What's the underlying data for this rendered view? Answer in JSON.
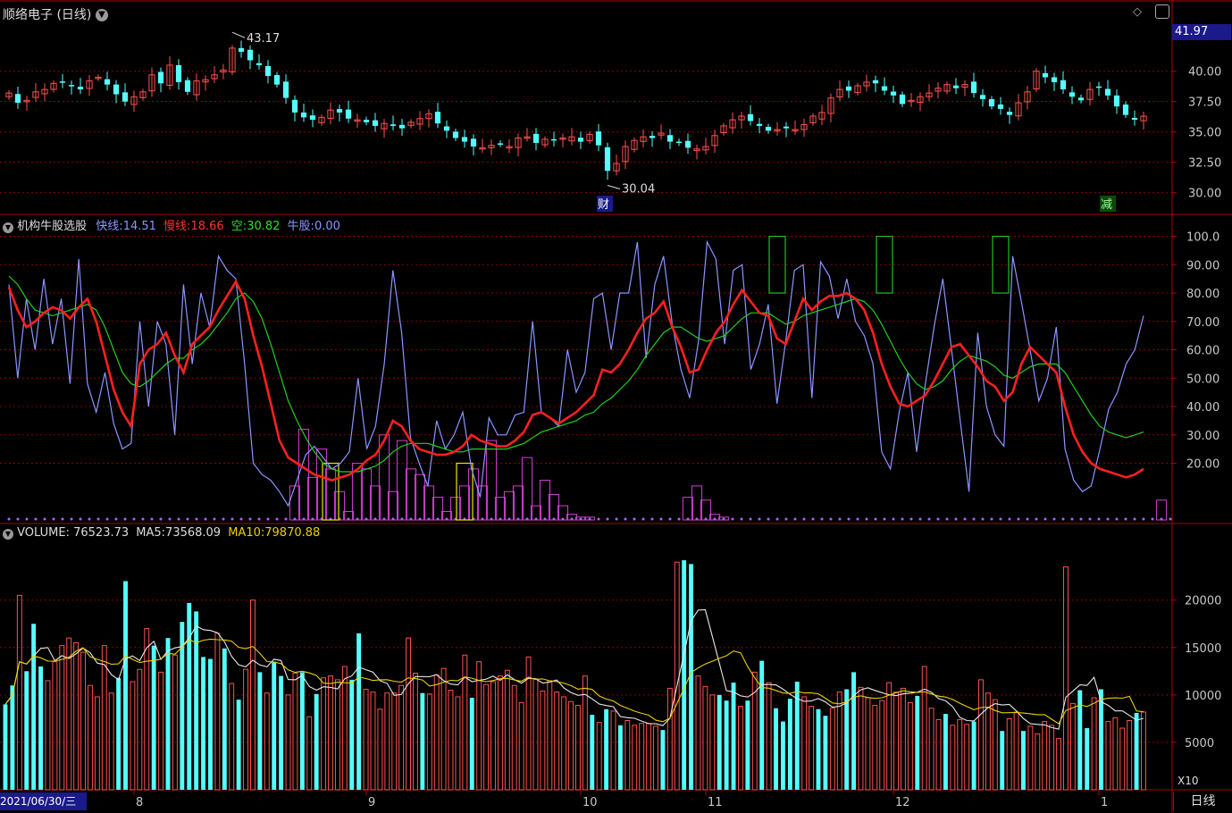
{
  "header": {
    "stock_name": "顺络电子",
    "period": "(日线)",
    "last_price": "41.97"
  },
  "price_panel": {
    "y_ticks": [
      "40.00",
      "37.50",
      "35.00",
      "32.50",
      "30.00"
    ],
    "high_label": "43.17",
    "low_label": "30.04",
    "marker_cai": "财",
    "marker_jian": "减"
  },
  "indicator_panel": {
    "name": "机构牛股选股",
    "fast_label": "快线:",
    "fast_value": "14.51",
    "slow_label": "慢线:",
    "slow_value": "18.66",
    "kong_label": "空:",
    "kong_value": "30.82",
    "niu_label": "牛股:",
    "niu_value": "0.00",
    "y_ticks": [
      "100.0",
      "90.00",
      "80.00",
      "70.00",
      "60.00",
      "50.00",
      "40.00",
      "30.00",
      "20.00"
    ]
  },
  "volume_panel": {
    "name": "VOLUME:",
    "volume_value": "76523.73",
    "ma5_label": "MA5:",
    "ma5_value": "73568.09",
    "ma10_label": "MA10:",
    "ma10_value": "79870.88",
    "y_ticks": [
      "20000",
      "15000",
      "10000",
      "5000"
    ],
    "unit": "X10"
  },
  "x_axis": {
    "start_date": "2021/06/30/三",
    "months": [
      "8",
      "9",
      "10",
      "11",
      "12",
      "1"
    ],
    "period_tab": "日线"
  },
  "colors": {
    "up": "#ff5050",
    "down": "#54ffff",
    "fast": "#8a96ff",
    "slow": "#ff2020",
    "kong": "#20d020",
    "niu": "#d040d0",
    "ma5": "#e8e8e8",
    "ma10": "#e8d000",
    "grid": "#8b0000"
  },
  "chart_data": [
    {
      "type": "candlestick",
      "title": "顺络电子 (日线)",
      "ylim": [
        28.8,
        43.8
      ],
      "series": [
        {
          "name": "price",
          "values": [
            38.2,
            37.4,
            37.6,
            38.3,
            38.5,
            39.0,
            39.1,
            38.8,
            38.5,
            39.2,
            39.5,
            38.9,
            38.1,
            37.5,
            37.9,
            38.3,
            39.7,
            39.0,
            40.5,
            39.1,
            38.3,
            39.2,
            39.3,
            39.7,
            40.1,
            41.9,
            41.6,
            40.9,
            40.5,
            39.6,
            38.9,
            37.8,
            36.6,
            36.2,
            36.0,
            36.2,
            36.8,
            36.6,
            36.1,
            36.0,
            35.8,
            35.5,
            35.7,
            35.5,
            35.3,
            35.8,
            36.1,
            36.5,
            35.7,
            35.1,
            34.5,
            34.2,
            33.8,
            33.7,
            33.9,
            34.0,
            33.8,
            34.5,
            34.6,
            34.1,
            34.4,
            34.3,
            34.5,
            34.6,
            34.2,
            34.8,
            33.9,
            31.8,
            32.4,
            33.8,
            34.3,
            34.6,
            34.5,
            34.9,
            34.2,
            34.1,
            33.7,
            33.6,
            33.8,
            34.7,
            35.5,
            36.0,
            36.3,
            35.9,
            35.5,
            35.1,
            35.2,
            35.3,
            35.2,
            35.6,
            36.3,
            36.6,
            37.8,
            38.5,
            38.4,
            38.8,
            39.1,
            39.0,
            38.4,
            38.0,
            37.3,
            37.6,
            37.9,
            38.2,
            38.6,
            38.9,
            38.6,
            38.9,
            38.2,
            37.7,
            37.1,
            36.9,
            36.4,
            37.4,
            38.3,
            40.0,
            39.5,
            39.1,
            38.5,
            37.9,
            37.6,
            38.5,
            38.7,
            38.0,
            37.1,
            36.4,
            36.0,
            36.3
          ]
        }
      ]
    },
    {
      "type": "line",
      "title": "机构牛股选股",
      "ylim": [
        0,
        103
      ],
      "series": [
        {
          "name": "快线",
          "values": [
            83,
            50,
            78,
            60,
            85,
            62,
            78,
            48,
            92,
            48,
            38,
            52,
            34,
            25,
            27,
            70,
            40,
            70,
            62,
            30,
            83,
            55,
            80,
            68,
            93,
            88,
            85,
            55,
            20,
            16,
            14,
            10,
            5,
            14,
            23,
            26,
            22,
            18,
            20,
            24,
            50,
            25,
            33,
            55,
            88,
            66,
            29,
            20,
            12,
            35,
            25,
            30,
            38,
            18,
            8,
            36,
            30,
            30,
            37,
            38,
            70,
            38,
            36,
            33,
            60,
            45,
            52,
            78,
            80,
            60,
            80,
            80,
            98,
            57,
            83,
            93,
            69,
            53,
            43,
            63,
            98,
            92,
            62,
            88,
            90,
            53,
            62,
            76,
            41,
            63,
            88,
            90,
            43,
            91,
            86,
            71,
            85,
            70,
            65,
            55,
            24,
            18,
            38,
            52,
            24,
            48,
            68,
            85,
            60,
            35,
            10,
            66,
            40,
            30,
            26,
            93,
            77,
            60,
            42,
            50,
            68,
            25,
            14,
            10,
            12,
            25,
            39,
            45,
            55,
            60,
            72
          ]
        },
        {
          "name": "慢线",
          "values": [
            82,
            74,
            68,
            70,
            73,
            75,
            74,
            71,
            75,
            78,
            70,
            58,
            46,
            38,
            33,
            55,
            60,
            62,
            66,
            58,
            52,
            62,
            65,
            68,
            74,
            79,
            84,
            78,
            65,
            54,
            41,
            28,
            22,
            20,
            18,
            16,
            15,
            14,
            15,
            16,
            18,
            21,
            23,
            28,
            35,
            33,
            28,
            25,
            24,
            23,
            23,
            24,
            26,
            30,
            28,
            27,
            26,
            26,
            28,
            31,
            37,
            38,
            36,
            34,
            36,
            38,
            41,
            44,
            53,
            52,
            55,
            60,
            66,
            71,
            73,
            77,
            68,
            61,
            52,
            53,
            60,
            66,
            70,
            76,
            81,
            77,
            73,
            72,
            64,
            62,
            70,
            78,
            74,
            77,
            79,
            79,
            80,
            78,
            74,
            66,
            55,
            47,
            41,
            40,
            42,
            44,
            49,
            55,
            61,
            62,
            58,
            54,
            49,
            47,
            42,
            45,
            55,
            61,
            58,
            55,
            52,
            40,
            30,
            24,
            20,
            18,
            17,
            16,
            15,
            16,
            18
          ]
        },
        {
          "name": "空",
          "values": [
            86,
            83,
            78,
            74,
            73,
            72,
            73,
            74,
            75,
            76,
            74,
            68,
            60,
            52,
            48,
            47,
            49,
            52,
            55,
            57,
            57,
            60,
            62,
            65,
            69,
            73,
            78,
            80,
            77,
            71,
            62,
            52,
            42,
            35,
            29,
            24,
            20,
            18,
            17,
            17,
            17,
            18,
            19,
            21,
            24,
            26,
            27,
            27,
            27,
            26,
            25,
            24,
            24,
            25,
            25,
            25,
            25,
            25,
            26,
            27,
            29,
            31,
            32,
            33,
            34,
            35,
            37,
            38,
            41,
            43,
            46,
            49,
            53,
            58,
            62,
            66,
            68,
            68,
            66,
            64,
            63,
            64,
            65,
            68,
            71,
            73,
            73,
            73,
            71,
            69,
            70,
            72,
            73,
            74,
            75,
            76,
            77,
            78,
            77,
            74,
            69,
            63,
            57,
            52,
            48,
            46,
            47,
            49,
            53,
            56,
            58,
            57,
            56,
            54,
            51,
            50,
            52,
            54,
            55,
            55,
            55,
            52,
            47,
            42,
            37,
            33,
            31,
            30,
            29,
            30,
            31
          ]
        },
        {
          "name": "牛股",
          "values": [
            0,
            0,
            0,
            0,
            0,
            0,
            0,
            0,
            0,
            0,
            0,
            0,
            0,
            0,
            0,
            0,
            0,
            0,
            0,
            0,
            0,
            0,
            0,
            0,
            0,
            0,
            0,
            0,
            0,
            0,
            0,
            0,
            12,
            32,
            15,
            25,
            18,
            10,
            3,
            20,
            18,
            12,
            30,
            10,
            28,
            18,
            16,
            12,
            8,
            3,
            8,
            12,
            18,
            12,
            28,
            8,
            10,
            12,
            22,
            5,
            14,
            9,
            5,
            2,
            1,
            1,
            0,
            0,
            0,
            0,
            0,
            0,
            0,
            0,
            0,
            0,
            8,
            12,
            7,
            2,
            1,
            0,
            0,
            0,
            0,
            0,
            0,
            0,
            0,
            0,
            0,
            0,
            0,
            0,
            0,
            0,
            0,
            0,
            0,
            0,
            0,
            0,
            0,
            0,
            0,
            0,
            0,
            0,
            0,
            0,
            0,
            0,
            0,
            0,
            0,
            0,
            0,
            0,
            0,
            0,
            0,
            0,
            0,
            0,
            0,
            0,
            0,
            0,
            0,
            7,
            0
          ]
        }
      ]
    },
    {
      "type": "bar",
      "title": "VOLUME",
      "ylim": [
        0,
        26000
      ],
      "series": [
        {
          "name": "VOLUME",
          "values": [
            9000,
            11000,
            20500,
            12500,
            17500,
            13000,
            11500,
            13500,
            15200,
            16000,
            15500,
            14500,
            11000,
            9800,
            15200,
            10200,
            11800,
            22000,
            11400,
            12700,
            17000,
            15200,
            12400,
            16000,
            14200,
            17700,
            19700,
            18800,
            14000,
            13800,
            16500,
            14900,
            11200,
            9500,
            12700,
            20000,
            12400,
            10200,
            13500,
            12000,
            10000,
            12300,
            12400,
            7700,
            10100,
            11800,
            12000,
            11600,
            13000,
            11600,
            16500,
            10600,
            10300,
            8500,
            10200,
            10200,
            11000,
            16000,
            12300,
            10200,
            10100,
            12100,
            12800,
            10500,
            9800,
            14200,
            9700,
            13500,
            11100,
            11400,
            12000,
            12600,
            11000,
            9200,
            14000,
            11700,
            10400,
            11500,
            10300,
            9800,
            9300,
            8900,
            12000,
            7900,
            7100,
            8500,
            8300,
            6800,
            7300,
            6800,
            7000,
            7000,
            6700,
            6300,
            10700,
            24000,
            24200,
            23800,
            12000,
            10900,
            10000,
            10000,
            9400,
            11300,
            8800,
            9400,
            12400,
            13600,
            11300,
            8600,
            7200,
            9600,
            11400,
            9800,
            8800,
            8500,
            7800,
            8600,
            10300,
            10600,
            12400,
            10800,
            9700,
            8900,
            9400,
            11300,
            10300,
            10700,
            9200,
            9900,
            13000,
            8600,
            7400,
            8000,
            6800,
            7400,
            6900,
            7200,
            11600,
            10200,
            9500,
            6200,
            7500,
            8200,
            6200,
            6700,
            5900,
            7200,
            6800,
            5400,
            23500,
            9100,
            10500,
            6500,
            9700,
            10600,
            7200,
            7600,
            6500,
            7300,
            8100,
            8200
          ]
        }
      ]
    }
  ]
}
